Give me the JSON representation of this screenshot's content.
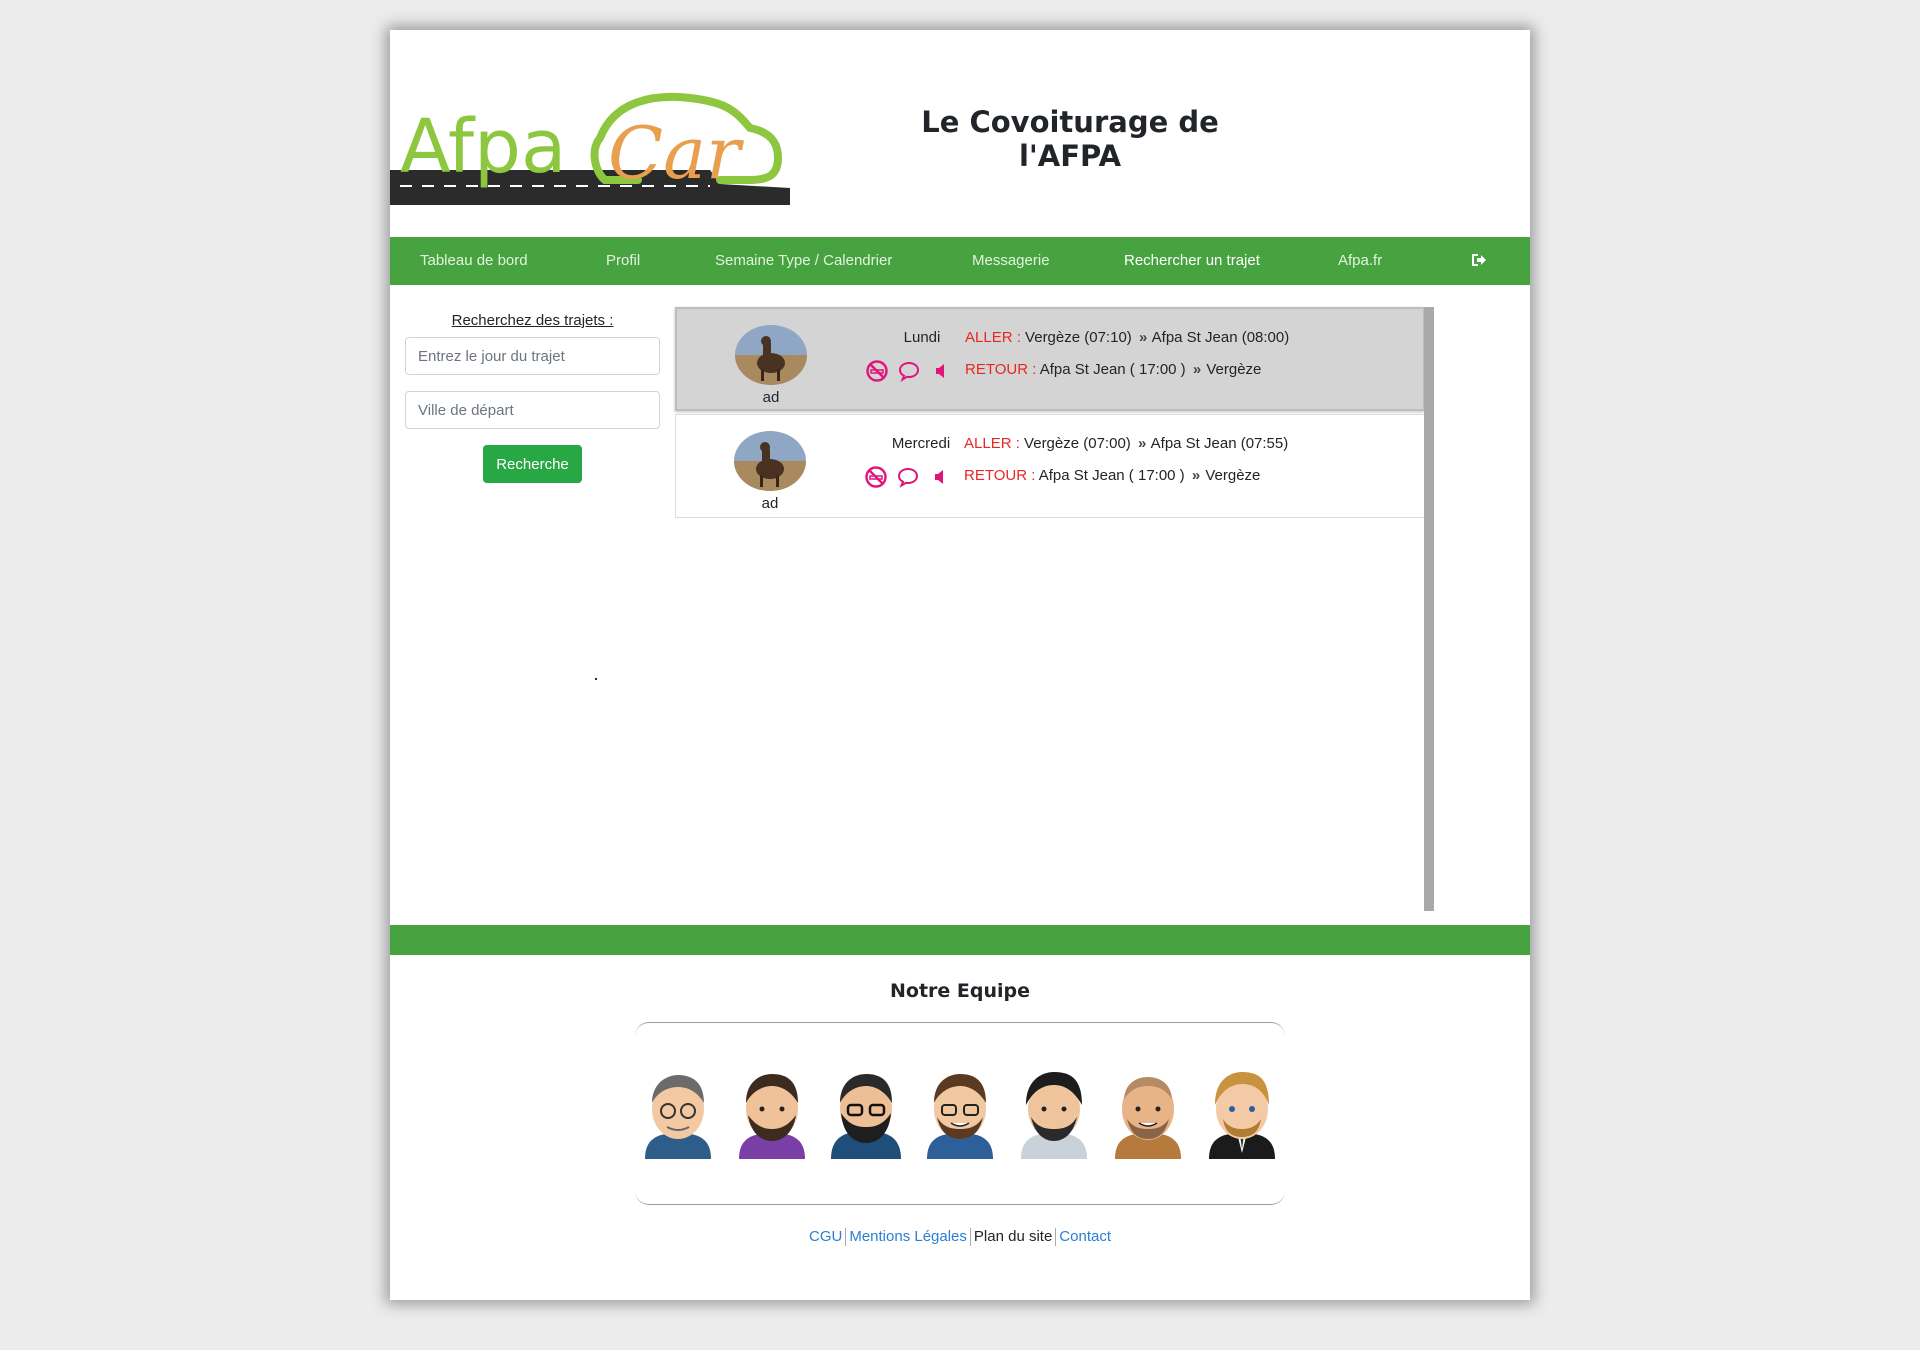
{
  "header": {
    "logo_text_1": "Afpa",
    "logo_text_2": "Car",
    "site_title": "Le Covoiturage de l'AFPA"
  },
  "nav": {
    "items": [
      {
        "label": "Tableau de bord"
      },
      {
        "label": "Profil"
      },
      {
        "label": "Semaine Type / Calendrier"
      },
      {
        "label": "Messagerie"
      },
      {
        "label": "Rechercher un trajet",
        "active": true
      },
      {
        "label": "Afpa.fr"
      }
    ],
    "logout_icon": "sign-out-icon"
  },
  "search": {
    "title": "Recherchez des trajets :",
    "day_placeholder": "Entrez le jour du trajet",
    "city_placeholder": "Ville de départ",
    "button_label": "Recherche"
  },
  "trips": [
    {
      "driver": "ad",
      "day": "Lundi",
      "aller_label": "ALLER :",
      "aller_from": "Vergèze (07:10)",
      "aller_to": "Afpa St Jean (08:00)",
      "retour_label": "RETOUR :",
      "retour_from": "Afpa St Jean ( 17:00 )",
      "retour_to": "Vergèze",
      "icons": [
        "no-smoking-icon",
        "chat-icon",
        "speaker-icon"
      ]
    },
    {
      "driver": "ad",
      "day": "Mercredi",
      "aller_label": "ALLER :",
      "aller_from": "Vergèze (07:00)",
      "aller_to": "Afpa St Jean (07:55)",
      "retour_label": "RETOUR :",
      "retour_from": "Afpa St Jean ( 17:00 )",
      "retour_to": "Vergèze",
      "icons": [
        "no-smoking-icon",
        "chat-icon",
        "speaker-icon"
      ]
    }
  ],
  "route_arrow": "»",
  "team": {
    "title": "Notre Equipe",
    "members": 7
  },
  "footer": {
    "links": [
      "CGU",
      "Mentions Légales",
      "Plan du site",
      "Contact"
    ]
  },
  "colors": {
    "brand_green": "#46a33f",
    "logo_green": "#8dc63f",
    "logo_orange": "#e8a04e",
    "accent_pink": "#e0157a",
    "route_label_red": "#e82626",
    "button_green": "#28a745"
  }
}
